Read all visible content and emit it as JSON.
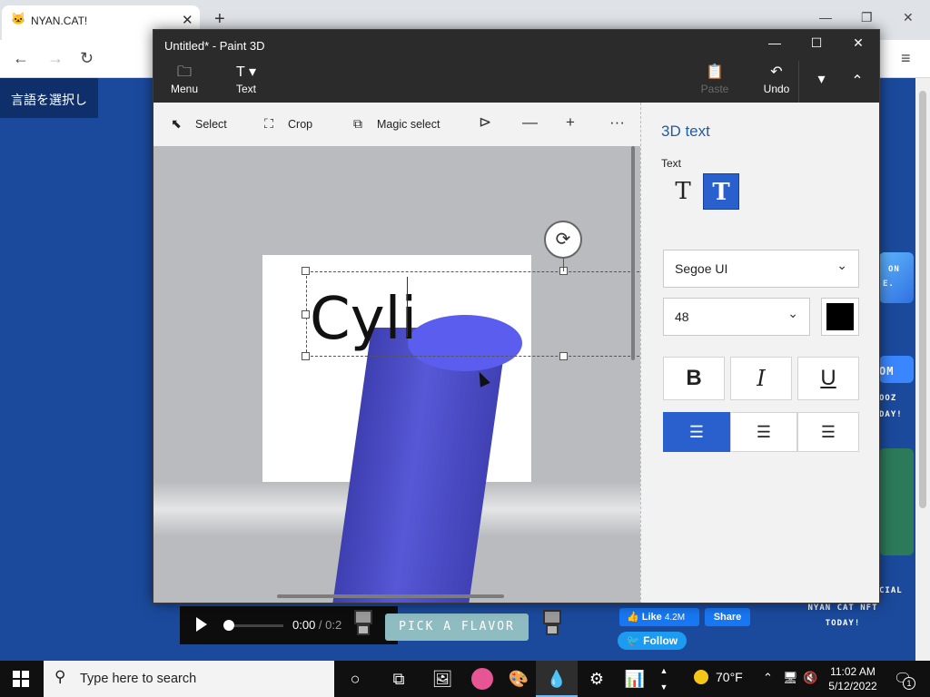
{
  "browser": {
    "tab_title": "NYAN.CAT!",
    "tab_close": "✕",
    "new_tab": "+",
    "win_minimize": "—",
    "win_restore": "❐",
    "win_close": "✕",
    "nav_back": "←",
    "nav_forward": "→",
    "nav_reload": "↻",
    "menu": "≡"
  },
  "page": {
    "language_button": "言語を選択し",
    "player": {
      "time_current": "0:00",
      "time_separator": " / ",
      "time_total": "0:2"
    },
    "flavor_button": "PICK A FLAVOR",
    "facebook": {
      "like_label": "Like",
      "like_count": "4.2M",
      "share_label": "Share"
    },
    "twitter": {
      "follow_label": "Follow"
    },
    "promo_lines": [
      "NYAN CAT NFT",
      "TODAY!"
    ],
    "side_fragments": [
      "ON",
      "E.",
      "OM",
      "OOZ",
      "DAY!",
      "CIAL"
    ]
  },
  "paint3d": {
    "title": "Untitled* - Paint 3D",
    "window": {
      "minimize": "—",
      "maximize": "☐",
      "close": "✕"
    },
    "ribbon": {
      "menu_label": "Menu",
      "text_label": "Text",
      "paste_label": "Paste",
      "undo_label": "Undo",
      "more": "▾",
      "collapse": "⌃"
    },
    "toolbar": {
      "select_label": "Select",
      "crop_label": "Crop",
      "magic_select_label": "Magic select",
      "more": "···"
    },
    "canvas": {
      "text_content": "Cyli"
    },
    "panel": {
      "title": "3D text",
      "text_section_label": "Text",
      "font_family": "Segoe UI",
      "font_size": "48",
      "text_color": "#000000",
      "bold": "B",
      "italic": "I",
      "underline": "U"
    }
  },
  "taskbar": {
    "search_placeholder": "Type here to search",
    "weather": "70°F",
    "time": "11:02 AM",
    "date": "5/12/2022",
    "notification_count": "1"
  },
  "colors": {
    "accent": "#2a5fce",
    "page_bg": "#1b4a9c",
    "cylinder": "#5658d6"
  }
}
